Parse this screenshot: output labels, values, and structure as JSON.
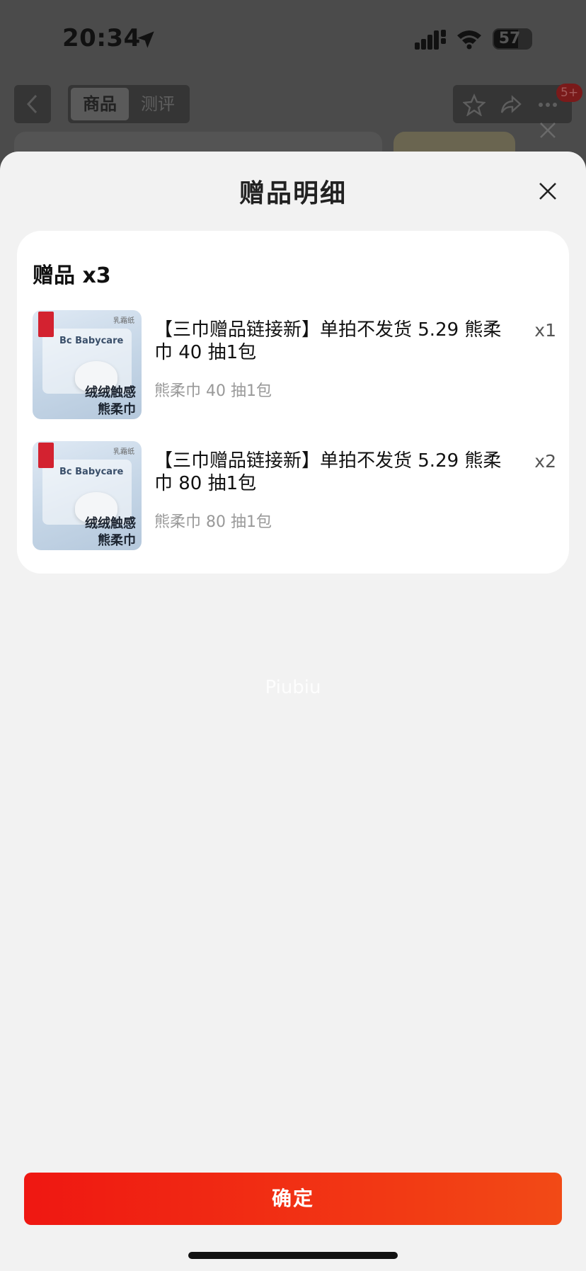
{
  "status_bar": {
    "time": "20:34",
    "battery": "57"
  },
  "nav": {
    "tabs": [
      {
        "label": "商品",
        "active": true
      },
      {
        "label": "测评",
        "active": false
      }
    ],
    "badge": "5+"
  },
  "sheet": {
    "title": "赠品明细",
    "gift_header": "赠品 x3",
    "items": [
      {
        "name": "【三巾赠品链接新】单拍不发货 5.29 熊柔巾 40 抽1包",
        "spec": "熊柔巾 40 抽1包",
        "qty": "x1",
        "thumb_tag": "乳霜纸",
        "thumb_brand": "Bc Babycare",
        "thumb_caption_1": "绒绒触感",
        "thumb_caption_2": "熊柔巾"
      },
      {
        "name": "【三巾赠品链接新】单拍不发货 5.29 熊柔巾 80 抽1包",
        "spec": "熊柔巾 80 抽1包",
        "qty": "x2",
        "thumb_tag": "乳霜纸",
        "thumb_brand": "Bc Babycare",
        "thumb_caption_1": "绒绒触感",
        "thumb_caption_2": "熊柔巾"
      }
    ],
    "watermark": "Piubiu",
    "confirm_label": "确定"
  },
  "colors": {
    "accent": "#f0241a",
    "overlay": "#4b4b4b",
    "sheet_bg": "#f2f2f2"
  },
  "icons": [
    "location-arrow-icon",
    "signal-icon",
    "wifi-icon",
    "battery-icon",
    "chevron-left-icon",
    "star-icon",
    "share-icon",
    "more-icon",
    "close-icon"
  ]
}
